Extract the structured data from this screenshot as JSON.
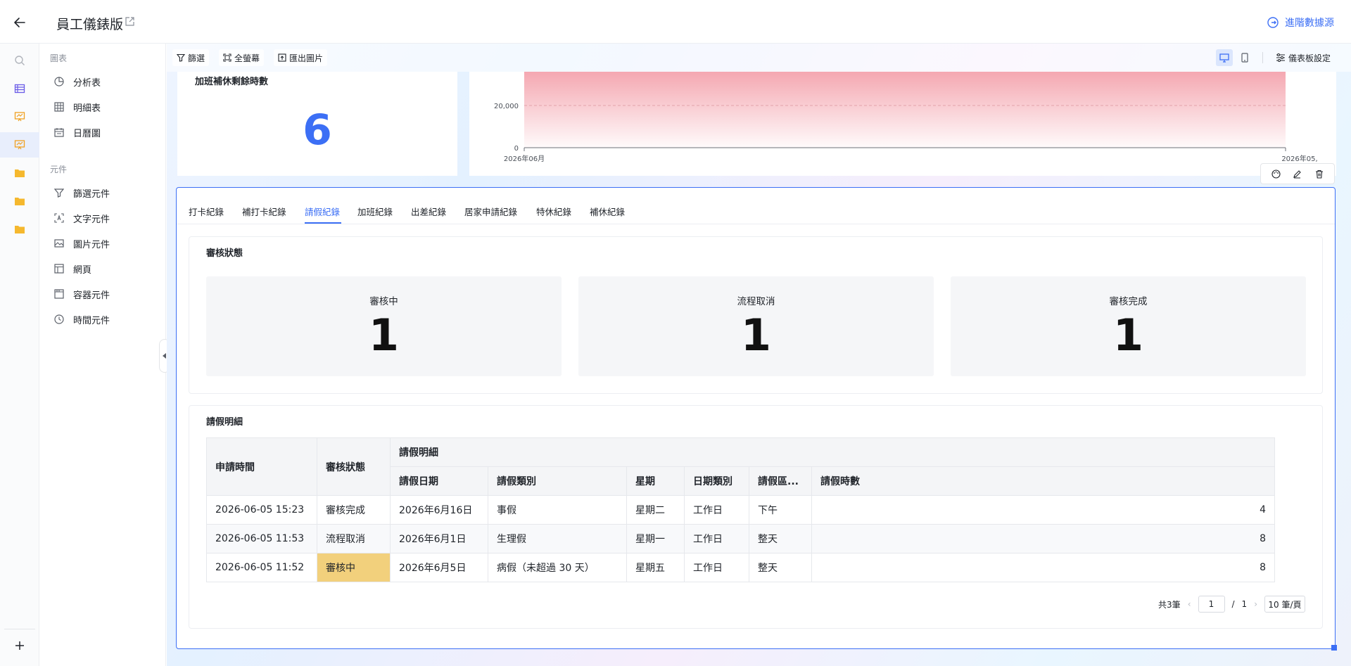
{
  "header": {
    "title": "員工儀錶版",
    "advanced_link": "進階數據源"
  },
  "panel": {
    "group_charts": "圖表",
    "charts": [
      {
        "label": "分析表",
        "icon": "pie-chart-icon"
      },
      {
        "label": "明細表",
        "icon": "table-grid-icon"
      },
      {
        "label": "日曆圖",
        "icon": "calendar-icon"
      }
    ],
    "group_components": "元件",
    "components": [
      {
        "label": "篩選元件",
        "icon": "filter-icon"
      },
      {
        "label": "文字元件",
        "icon": "text-icon"
      },
      {
        "label": "圖片元件",
        "icon": "image-icon"
      },
      {
        "label": "網頁",
        "icon": "webpage-icon"
      },
      {
        "label": "容器元件",
        "icon": "container-icon"
      },
      {
        "label": "時間元件",
        "icon": "clock-icon"
      }
    ]
  },
  "toolbar": {
    "filter": "篩選",
    "fullscreen": "全螢幕",
    "export_image": "匯出圖片",
    "settings": "儀表板設定"
  },
  "kpi_card": {
    "title": "加班補休剩餘時數",
    "value": "6"
  },
  "area_chart": {
    "y_ticks": [
      "20,000",
      "0"
    ],
    "x_start": "2026年06月",
    "x_end": "2026年05,"
  },
  "tabs": {
    "items": [
      "打卡紀錄",
      "補打卡紀錄",
      "請假紀錄",
      "加班紀錄",
      "出差紀錄",
      "居家申請紀錄",
      "特休紀錄",
      "補休紀錄"
    ],
    "active_index": 2
  },
  "status_section": {
    "title": "審核狀態",
    "stats": [
      {
        "label": "審核中",
        "value": "1"
      },
      {
        "label": "流程取消",
        "value": "1"
      },
      {
        "label": "審核完成",
        "value": "1"
      }
    ]
  },
  "detail_section": {
    "title": "請假明細",
    "headers": {
      "apply_time": "申請時間",
      "status": "審核狀態",
      "group": "請假明細",
      "date": "請假日期",
      "type": "請假類別",
      "weekday": "星期",
      "day_type": "日期類別",
      "range": "請假區...",
      "hours": "請假時數"
    },
    "rows": [
      {
        "apply_time": "2026-06-05 15:23",
        "status": "審核完成",
        "date": "2026年6月16日",
        "type": "事假",
        "weekday": "星期二",
        "day_type": "工作日",
        "range": "下午",
        "hours": "4"
      },
      {
        "apply_time": "2026-06-05 11:53",
        "status": "流程取消",
        "date": "2026年6月1日",
        "type": "生理假",
        "weekday": "星期一",
        "day_type": "工作日",
        "range": "整天",
        "hours": "8"
      },
      {
        "apply_time": "2026-06-05 11:52",
        "status": "審核中",
        "date": "2026年6月5日",
        "type": "病假（未超過 30 天）",
        "weekday": "星期五",
        "day_type": "工作日",
        "range": "整天",
        "hours": "8"
      }
    ],
    "pager": {
      "total": "共3筆",
      "current": "1",
      "separator": "/",
      "pages": "1",
      "page_size": "10 筆/頁"
    }
  },
  "colors": {
    "accent": "#3c6ff5",
    "highlight": "#f2d07c",
    "area_fill": "#f4a3ad"
  }
}
